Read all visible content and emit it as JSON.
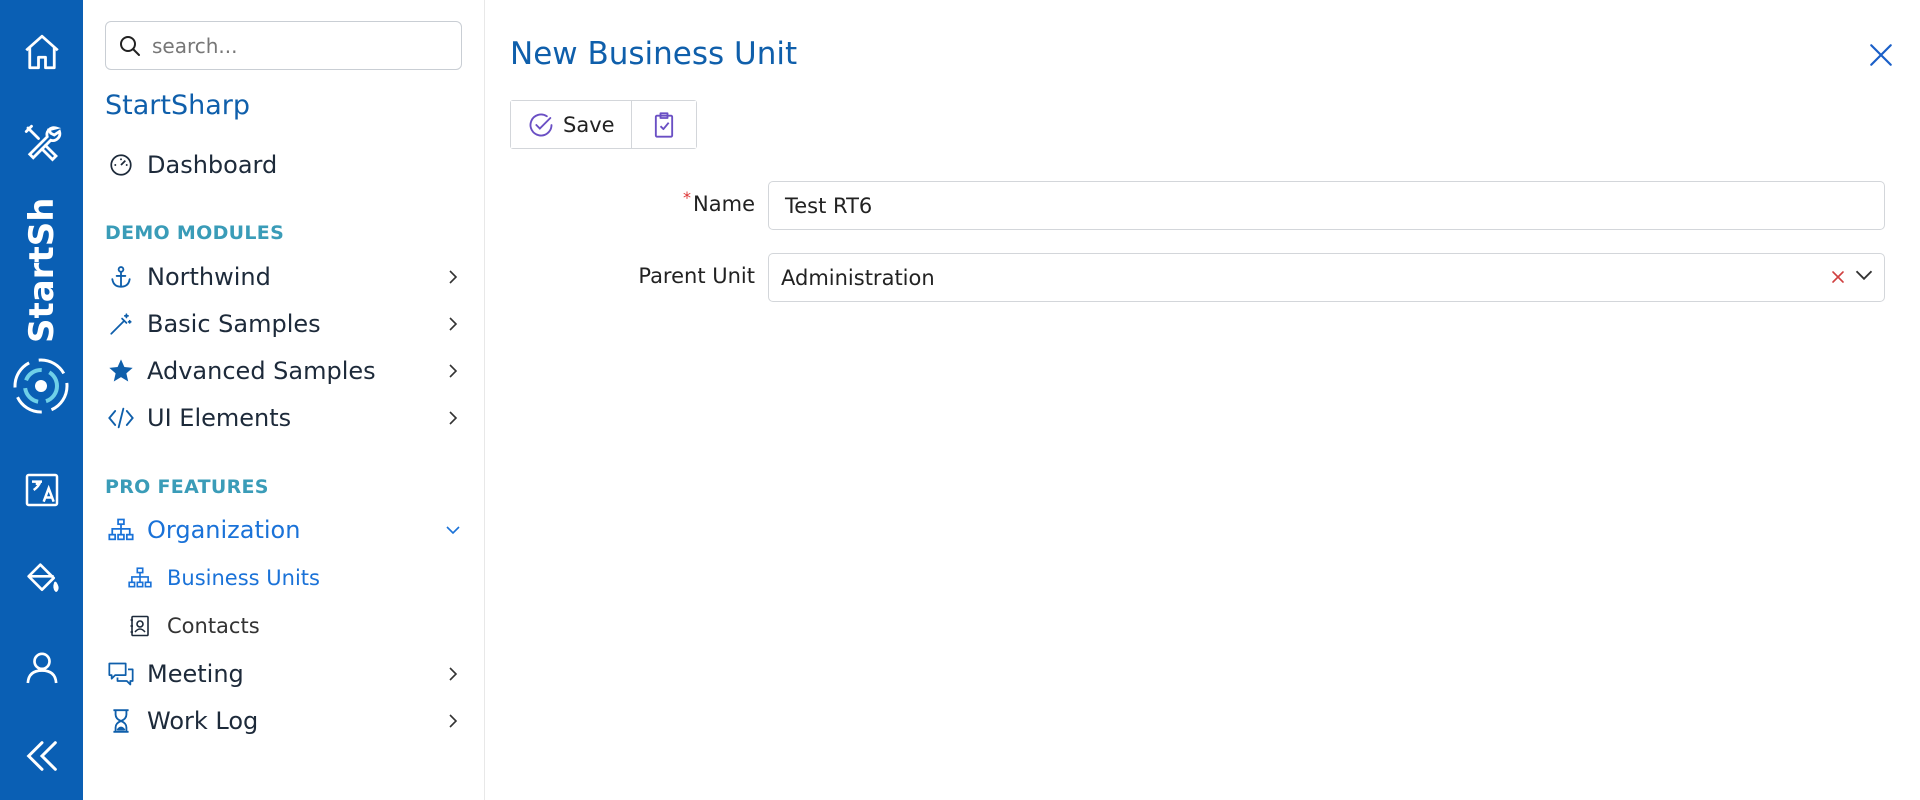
{
  "rail": {
    "logo_text": "StartSh",
    "colors": {
      "background": "#0a5fb4",
      "logo_accent": "#6fd0e8"
    },
    "icons": [
      "home-icon",
      "tools-icon",
      "translate-icon",
      "paint-bucket-icon",
      "user-icon",
      "collapse-double-chevron-icon"
    ]
  },
  "sidebar": {
    "search_placeholder": "search...",
    "brand": "StartSharp",
    "dashboard": "Dashboard",
    "section_demo": "DEMO MODULES",
    "northwind": "Northwind",
    "basic_samples": "Basic Samples",
    "advanced_samples": "Advanced Samples",
    "ui_elements": "UI Elements",
    "section_pro": "PRO FEATURES",
    "organization": "Organization",
    "business_units": "Business Units",
    "contacts": "Contacts",
    "meeting": "Meeting",
    "work_log": "Work Log"
  },
  "dialog": {
    "title": "New Business Unit",
    "save_label": "Save",
    "name_label": "Name",
    "name_required_mark": "*",
    "name_value": "Test RT6",
    "parent_label": "Parent Unit",
    "parent_value": "Administration"
  },
  "colors": {
    "accent": "#0f5fab",
    "active": "#1a72d8",
    "section": "#3a9cb8",
    "save_icon": "#6a4fc4",
    "clear_x": "#d04040"
  }
}
